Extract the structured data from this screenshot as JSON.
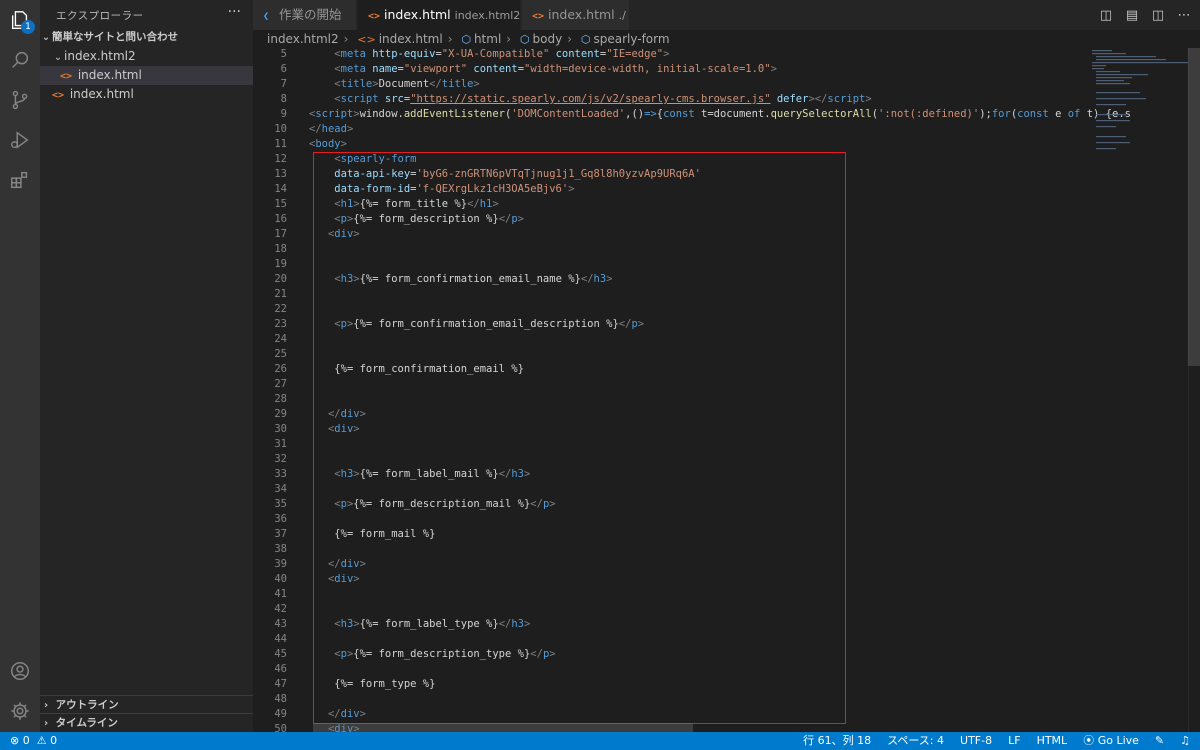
{
  "activity_bar": {
    "explorer_badge": "1"
  },
  "sidebar": {
    "title": "エクスプローラー",
    "more": "···",
    "folder": "簡単なサイトと問い合わせ",
    "tree": [
      {
        "label": "index.html2",
        "kind": "folder"
      },
      {
        "label": "index.html",
        "kind": "file",
        "selected": true
      },
      {
        "label": "index.html",
        "kind": "file"
      }
    ],
    "outline": "アウトライン",
    "timeline": "タイムライン"
  },
  "tabs": [
    {
      "label": "作業の開始",
      "description": "",
      "active": false
    },
    {
      "label": "index.html",
      "description": "index.html2",
      "active": true,
      "dirty": true
    },
    {
      "label": "index.html",
      "description": "./",
      "active": false
    }
  ],
  "breadcrumb": [
    "index.html2",
    "index.html",
    "html",
    "body",
    "spearly-form"
  ],
  "editor": {
    "lines": [
      {
        "n": "5",
        "tokens": [
          [
            "pl",
            "    "
          ],
          [
            "bk",
            "<"
          ],
          [
            "tg",
            "meta"
          ],
          [
            "pl",
            " "
          ],
          [
            "at",
            "http-equiv"
          ],
          [
            "pl",
            "="
          ],
          [
            "st",
            "\"X-UA-Compatible\""
          ],
          [
            "pl",
            " "
          ],
          [
            "at",
            "content"
          ],
          [
            "pl",
            "="
          ],
          [
            "st",
            "\"IE=edge\""
          ],
          [
            "bk",
            ">"
          ]
        ]
      },
      {
        "n": "6",
        "tokens": [
          [
            "pl",
            "    "
          ],
          [
            "bk",
            "<"
          ],
          [
            "tg",
            "meta"
          ],
          [
            "pl",
            " "
          ],
          [
            "at",
            "name"
          ],
          [
            "pl",
            "="
          ],
          [
            "st",
            "\"viewport\""
          ],
          [
            "pl",
            " "
          ],
          [
            "at",
            "content"
          ],
          [
            "pl",
            "="
          ],
          [
            "st",
            "\"width=device-width, initial-scale=1.0\""
          ],
          [
            "bk",
            ">"
          ]
        ]
      },
      {
        "n": "7",
        "tokens": [
          [
            "pl",
            "    "
          ],
          [
            "bk",
            "<"
          ],
          [
            "tg",
            "title"
          ],
          [
            "bk",
            ">"
          ],
          [
            "tx",
            "Document"
          ],
          [
            "bk",
            "</"
          ],
          [
            "tg",
            "title"
          ],
          [
            "bk",
            ">"
          ]
        ]
      },
      {
        "n": "8",
        "tokens": [
          [
            "pl",
            "    "
          ],
          [
            "bk",
            "<"
          ],
          [
            "tg",
            "script"
          ],
          [
            "pl",
            " "
          ],
          [
            "at",
            "src"
          ],
          [
            "pl",
            "="
          ],
          [
            "link",
            "\"https://static.spearly.com/js/v2/spearly-cms.browser.js\""
          ],
          [
            "pl",
            " "
          ],
          [
            "at",
            "defer"
          ],
          [
            "bk",
            "></"
          ],
          [
            "tg",
            "script"
          ],
          [
            "bk",
            ">"
          ]
        ]
      },
      {
        "n": "9",
        "tokens": [
          [
            "bk",
            "<"
          ],
          [
            "tg",
            "script"
          ],
          [
            "bk",
            ">"
          ],
          [
            "tx",
            "window."
          ],
          [
            "fn",
            "addEventListener"
          ],
          [
            "tx",
            "("
          ],
          [
            "st",
            "'DOMContentLoaded'"
          ],
          [
            "tx",
            ",()"
          ],
          [
            "kw",
            "=>"
          ],
          [
            "tx",
            "{"
          ],
          [
            "kw",
            "const"
          ],
          [
            "tx",
            " t=document."
          ],
          [
            "fn",
            "querySelectorAll"
          ],
          [
            "tx",
            "("
          ],
          [
            "st",
            "':not(:defined)'"
          ],
          [
            "tx",
            ");"
          ],
          [
            "kw",
            "for"
          ],
          [
            "tx",
            "("
          ],
          [
            "kw",
            "const"
          ],
          [
            "tx",
            " e "
          ],
          [
            "kw",
            "of"
          ],
          [
            "tx",
            " t) {e.s"
          ]
        ]
      },
      {
        "n": "10",
        "tokens": [
          [
            "bk",
            "</"
          ],
          [
            "tg",
            "head"
          ],
          [
            "bk",
            ">"
          ]
        ]
      },
      {
        "n": "11",
        "tokens": [
          [
            "bk",
            "<"
          ],
          [
            "tg",
            "body"
          ],
          [
            "bk",
            ">"
          ]
        ]
      },
      {
        "n": "12",
        "tokens": [
          [
            "pl",
            "    "
          ],
          [
            "bk",
            "<"
          ],
          [
            "tg",
            "spearly-form"
          ]
        ]
      },
      {
        "n": "13",
        "tokens": [
          [
            "pl",
            "    "
          ],
          [
            "at",
            "data-api-key"
          ],
          [
            "pl",
            "="
          ],
          [
            "st",
            "'byG6-znGRTN6pVTqTjnug1j1_Gq8l8h0yzvAp9URq6A'"
          ]
        ]
      },
      {
        "n": "14",
        "tokens": [
          [
            "pl",
            "    "
          ],
          [
            "at",
            "data-form-id"
          ],
          [
            "pl",
            "="
          ],
          [
            "st",
            "'f-QEXrgLkz1cH3OA5eBjv6'"
          ],
          [
            "bk",
            ">"
          ]
        ]
      },
      {
        "n": "15",
        "tokens": [
          [
            "pl",
            "    "
          ],
          [
            "bk",
            "<"
          ],
          [
            "tg",
            "h1"
          ],
          [
            "bk",
            ">"
          ],
          [
            "tx",
            "{%= form_title %}"
          ],
          [
            "bk",
            "</"
          ],
          [
            "tg",
            "h1"
          ],
          [
            "bk",
            ">"
          ]
        ]
      },
      {
        "n": "16",
        "tokens": [
          [
            "pl",
            "    "
          ],
          [
            "bk",
            "<"
          ],
          [
            "tg",
            "p"
          ],
          [
            "bk",
            ">"
          ],
          [
            "tx",
            "{%= form_description %}"
          ],
          [
            "bk",
            "</"
          ],
          [
            "tg",
            "p"
          ],
          [
            "bk",
            ">"
          ]
        ]
      },
      {
        "n": "17",
        "tokens": [
          [
            "pl",
            "   "
          ],
          [
            "bk",
            "<"
          ],
          [
            "tg",
            "div"
          ],
          [
            "bk",
            ">"
          ]
        ]
      },
      {
        "n": "18",
        "tokens": []
      },
      {
        "n": "19",
        "tokens": []
      },
      {
        "n": "20",
        "tokens": [
          [
            "pl",
            "    "
          ],
          [
            "bk",
            "<"
          ],
          [
            "tg",
            "h3"
          ],
          [
            "bk",
            ">"
          ],
          [
            "tx",
            "{%= form_confirmation_email_name %}"
          ],
          [
            "bk",
            "</"
          ],
          [
            "tg",
            "h3"
          ],
          [
            "bk",
            ">"
          ]
        ]
      },
      {
        "n": "21",
        "tokens": []
      },
      {
        "n": "22",
        "tokens": []
      },
      {
        "n": "23",
        "tokens": [
          [
            "pl",
            "    "
          ],
          [
            "bk",
            "<"
          ],
          [
            "tg",
            "p"
          ],
          [
            "bk",
            ">"
          ],
          [
            "tx",
            "{%= form_confirmation_email_description %}"
          ],
          [
            "bk",
            "</"
          ],
          [
            "tg",
            "p"
          ],
          [
            "bk",
            ">"
          ]
        ]
      },
      {
        "n": "24",
        "tokens": []
      },
      {
        "n": "25",
        "tokens": []
      },
      {
        "n": "26",
        "tokens": [
          [
            "pl",
            "    "
          ],
          [
            "tx",
            "{%= form_confirmation_email %}"
          ]
        ]
      },
      {
        "n": "27",
        "tokens": []
      },
      {
        "n": "28",
        "tokens": []
      },
      {
        "n": "29",
        "tokens": [
          [
            "pl",
            "   "
          ],
          [
            "bk",
            "</"
          ],
          [
            "tg",
            "div"
          ],
          [
            "bk",
            ">"
          ]
        ]
      },
      {
        "n": "30",
        "tokens": [
          [
            "pl",
            "   "
          ],
          [
            "bk",
            "<"
          ],
          [
            "tg",
            "div"
          ],
          [
            "bk",
            ">"
          ]
        ]
      },
      {
        "n": "31",
        "tokens": []
      },
      {
        "n": "32",
        "tokens": []
      },
      {
        "n": "33",
        "tokens": [
          [
            "pl",
            "    "
          ],
          [
            "bk",
            "<"
          ],
          [
            "tg",
            "h3"
          ],
          [
            "bk",
            ">"
          ],
          [
            "tx",
            "{%= form_label_mail %}"
          ],
          [
            "bk",
            "</"
          ],
          [
            "tg",
            "h3"
          ],
          [
            "bk",
            ">"
          ]
        ]
      },
      {
        "n": "34",
        "tokens": []
      },
      {
        "n": "35",
        "tokens": [
          [
            "pl",
            "    "
          ],
          [
            "bk",
            "<"
          ],
          [
            "tg",
            "p"
          ],
          [
            "bk",
            ">"
          ],
          [
            "tx",
            "{%= form_description_mail %}"
          ],
          [
            "bk",
            "</"
          ],
          [
            "tg",
            "p"
          ],
          [
            "bk",
            ">"
          ]
        ]
      },
      {
        "n": "36",
        "tokens": []
      },
      {
        "n": "37",
        "tokens": [
          [
            "pl",
            "    "
          ],
          [
            "tx",
            "{%= form_mail %}"
          ]
        ]
      },
      {
        "n": "38",
        "tokens": []
      },
      {
        "n": "39",
        "tokens": [
          [
            "pl",
            "   "
          ],
          [
            "bk",
            "</"
          ],
          [
            "tg",
            "div"
          ],
          [
            "bk",
            ">"
          ]
        ]
      },
      {
        "n": "40",
        "tokens": [
          [
            "pl",
            "   "
          ],
          [
            "bk",
            "<"
          ],
          [
            "tg",
            "div"
          ],
          [
            "bk",
            ">"
          ]
        ]
      },
      {
        "n": "41",
        "tokens": []
      },
      {
        "n": "42",
        "tokens": []
      },
      {
        "n": "43",
        "tokens": [
          [
            "pl",
            "    "
          ],
          [
            "bk",
            "<"
          ],
          [
            "tg",
            "h3"
          ],
          [
            "bk",
            ">"
          ],
          [
            "tx",
            "{%= form_label_type %}"
          ],
          [
            "bk",
            "</"
          ],
          [
            "tg",
            "h3"
          ],
          [
            "bk",
            ">"
          ]
        ]
      },
      {
        "n": "44",
        "tokens": []
      },
      {
        "n": "45",
        "tokens": [
          [
            "pl",
            "    "
          ],
          [
            "bk",
            "<"
          ],
          [
            "tg",
            "p"
          ],
          [
            "bk",
            ">"
          ],
          [
            "tx",
            "{%= form_description_type %}"
          ],
          [
            "bk",
            "</"
          ],
          [
            "tg",
            "p"
          ],
          [
            "bk",
            ">"
          ]
        ]
      },
      {
        "n": "46",
        "tokens": []
      },
      {
        "n": "47",
        "tokens": [
          [
            "pl",
            "    "
          ],
          [
            "tx",
            "{%= form_type %}"
          ]
        ]
      },
      {
        "n": "48",
        "tokens": []
      },
      {
        "n": "49",
        "tokens": [
          [
            "pl",
            "   "
          ],
          [
            "bk",
            "</"
          ],
          [
            "tg",
            "div"
          ],
          [
            "bk",
            ">"
          ]
        ]
      },
      {
        "n": "50",
        "tokens": [
          [
            "pl",
            "   "
          ],
          [
            "bk",
            "<"
          ],
          [
            "tg",
            "div"
          ],
          [
            "bk",
            ">"
          ]
        ]
      }
    ]
  },
  "status": {
    "errors": "0",
    "warnings": "0",
    "position": "行 61、列 18",
    "indent": "スペース: 4",
    "encoding": "UTF-8",
    "eol": "LF",
    "language": "HTML",
    "golive": "Go Live"
  },
  "colors": {
    "accent": "#007acc",
    "highlight": "#e51c23"
  }
}
